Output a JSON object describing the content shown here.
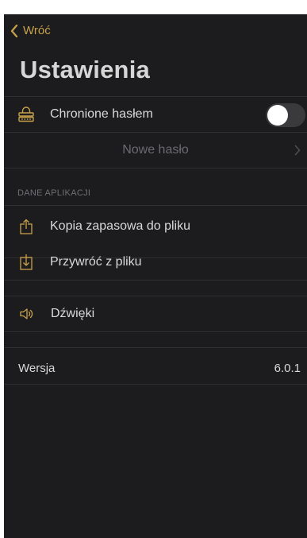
{
  "nav": {
    "back_label": "Wróć"
  },
  "page": {
    "title": "Ustawienia"
  },
  "security": {
    "password_protected_label": "Chronione hasłem",
    "password_protected_enabled": false,
    "new_password_label": "Nowe hasło"
  },
  "app_data": {
    "section_header": "DANE APLIKACJI",
    "backup_label": "Kopia zapasowa do pliku",
    "restore_label": "Przywróć z pliku"
  },
  "sounds": {
    "label": "Dźwięki"
  },
  "version": {
    "label": "Wersja",
    "value": "6.0.1"
  },
  "colors": {
    "background": "#1c1c1e",
    "accent": "#c8a24a",
    "text": "#d9d9d9",
    "muted": "#6b6b6f",
    "separator": "#303032"
  },
  "icons": {
    "back": "chevron-left-icon",
    "password": "password-lock-icon",
    "backup": "share-export-icon",
    "restore": "import-download-icon",
    "sounds": "speaker-icon",
    "new_password_chevron": "chevron-right-icon"
  }
}
